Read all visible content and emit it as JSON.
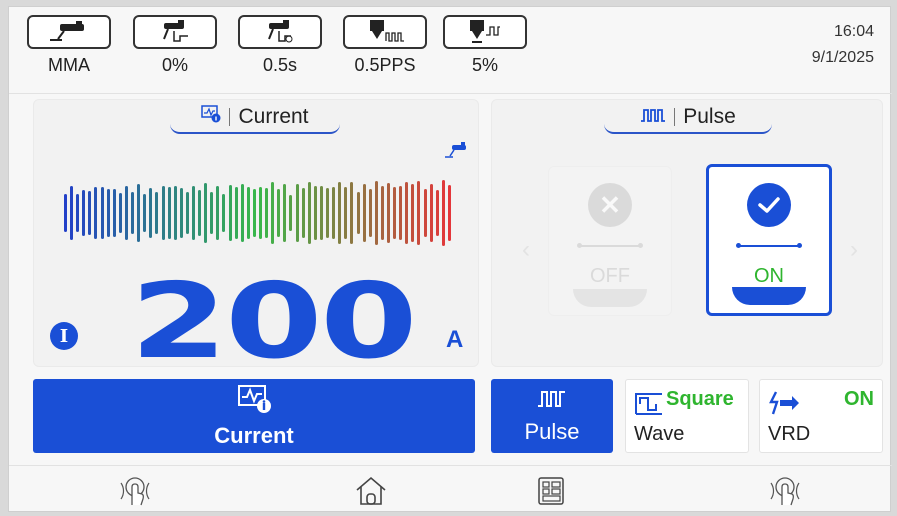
{
  "status_bar": {
    "items": [
      {
        "icon": "torch-icon",
        "label": "MMA"
      },
      {
        "icon": "torch-hot-start-icon",
        "label": "0%"
      },
      {
        "icon": "torch-arc-time-icon",
        "label": "0.5s"
      },
      {
        "icon": "tig-pulse-frequency-icon",
        "label": "0.5PPS"
      },
      {
        "icon": "tig-pulse-ratio-icon",
        "label": "5%"
      }
    ],
    "time": "16:04",
    "date": "9/1/2025"
  },
  "current_panel": {
    "tab_icon": "monitor-info-icon",
    "tab_label": "Current",
    "mode_icon": "torch-icon",
    "value": "200",
    "unit": "A",
    "badge": "I"
  },
  "pulse_panel": {
    "tab_icon": "pulse-wave-icon",
    "tab_label": "Pulse",
    "options": [
      {
        "label": "OFF",
        "selected": false
      },
      {
        "label": "ON",
        "selected": true
      }
    ]
  },
  "function_keys": {
    "current": {
      "label": "Current",
      "icon": "monitor-info-icon"
    },
    "pulse": {
      "label": "Pulse",
      "icon": "pulse-wave-icon"
    },
    "wave": {
      "label": "Wave",
      "value": "Square",
      "icon": "square-wave-icon"
    },
    "vrd": {
      "label": "VRD",
      "value": "ON",
      "icon": "vrd-icon"
    }
  },
  "nav": {
    "left": "touch-icon",
    "home": "home-icon",
    "menu": "menu-grid-icon",
    "right": "touch-icon"
  },
  "colors": {
    "accent": "#1a4fd6",
    "on_green": "#2fb52f",
    "meter_start": "#2340c8",
    "meter_mid": "#38b84a",
    "meter_end": "#e4363a"
  }
}
